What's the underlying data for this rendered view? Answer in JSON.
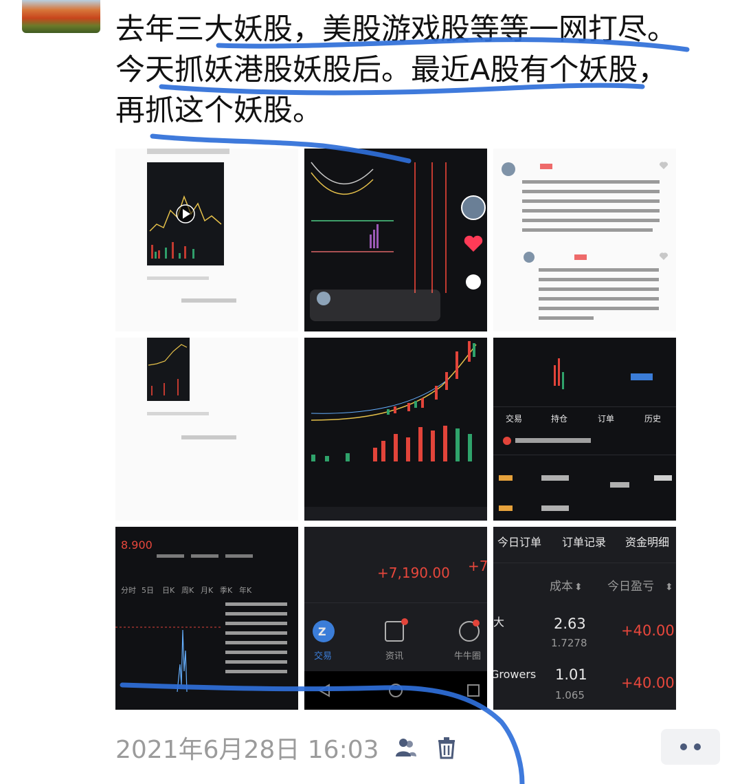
{
  "post": {
    "lines": [
      "去年三大妖股，美股游戏股等等一网打尽。",
      "今天抓妖港股妖股后。最近A股有个妖股，",
      "再抓这个妖股。"
    ]
  },
  "meta": {
    "timestamp": "2021年6月28日 16:03"
  },
  "thumbs": {
    "t6": {
      "tabs": [
        "交易",
        "持仓",
        "订单",
        "历史"
      ]
    },
    "t8": {
      "amount": "+7,190.00",
      "amount_cut": "+7",
      "nav": [
        "交易",
        "资讯",
        "牛牛圈"
      ]
    },
    "t9": {
      "tabs": [
        "今日订单",
        "订单记录",
        "资金明细"
      ],
      "headers": [
        "成本",
        "今日盈亏"
      ],
      "rows": [
        {
          "name": "大",
          "cost": "2.63",
          "sub": "1.7278",
          "pnl": "+40.00"
        },
        {
          "name": "Growers",
          "cost": "1.01",
          "sub": "1.065",
          "pnl": "+40.00"
        }
      ]
    },
    "t7": {
      "price": "8.900",
      "tabs": [
        "分时",
        "5日",
        "日K",
        "周K",
        "月K",
        "季K",
        "年K"
      ]
    }
  },
  "colors": {
    "accent_blue": "#3b7dd8",
    "up_red": "#e8473c",
    "link_blue": "#4b5a7a"
  }
}
